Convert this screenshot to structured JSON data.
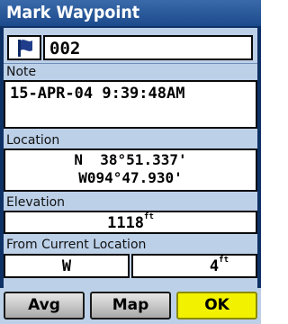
{
  "window": {
    "title": "Mark Waypoint"
  },
  "waypoint": {
    "flag_icon": "flag-icon",
    "name": "002"
  },
  "note": {
    "label": "Note",
    "value": "15-APR-04 9:39:48AM"
  },
  "location": {
    "label": "Location",
    "line1": "N  38°51.337'",
    "line2": "W094°47.930'"
  },
  "elevation": {
    "label": "Elevation",
    "value": "1118",
    "unit": "ft"
  },
  "from_current": {
    "label": "From Current Location",
    "bearing": "W",
    "distance": "4",
    "unit": "ft"
  },
  "buttons": {
    "avg": "Avg",
    "map": "Map",
    "ok": "OK"
  },
  "colors": {
    "title_bar": "#1c4a8c",
    "panel": "#bcd0e8",
    "ok_button": "#f2f200",
    "flag": "#1f3d8a"
  }
}
